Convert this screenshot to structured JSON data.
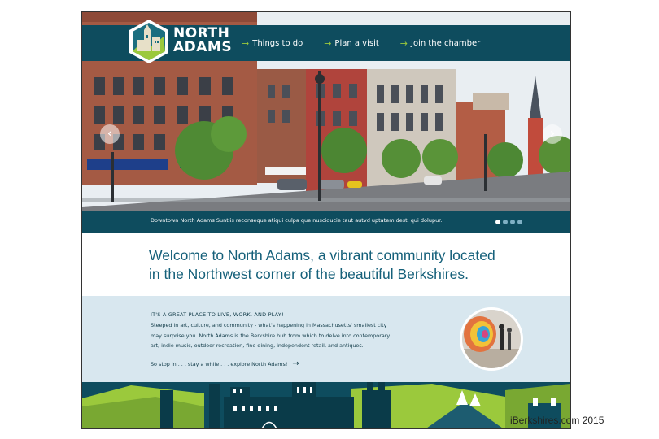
{
  "brand": {
    "logo_line1": "NORTH",
    "logo_line2": "ADAMS"
  },
  "nav": {
    "items": [
      {
        "label": "Things to do"
      },
      {
        "label": "Plan a visit"
      },
      {
        "label": "Join the chamber"
      }
    ]
  },
  "hero": {
    "caption": "Downtown North Adams Suntiis reconseque atiqui culpa que nusciducie taut autvd uptatem dest, qui dolupur.",
    "slide_count": 4,
    "active_slide": 1,
    "prev_symbol": "‹",
    "next_symbol": "›"
  },
  "welcome": {
    "line1": "Welcome to North Adams, a vibrant community located",
    "line2": "in the Northwest corner of the beautiful Berkshires."
  },
  "info": {
    "title": "IT'S A GREAT PLACE TO LIVE, WORK, AND PLAY!",
    "body_line1": "Steeped in art, culture, and community - what's happening in Massachusetts' smallest city",
    "body_line2": "may surprise you. North Adams is the Berkshire hub from which to delve into contemporary",
    "body_line3": "art, indie music, outdoor recreation, fine dining, independent retail, and antiques.",
    "cta": "So stop in . . . stay a while . . . explore North Adams!"
  },
  "watermark": "iBerkshires.com 2015",
  "colors": {
    "navy": "#0e4c5e",
    "accent_green": "#9bc93c",
    "info_bg": "#d8e7ef",
    "welcome_text": "#15607a"
  }
}
